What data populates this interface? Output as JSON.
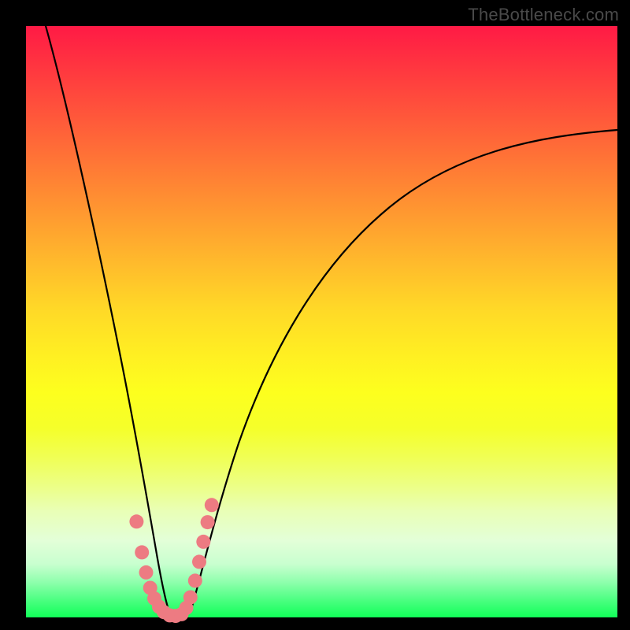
{
  "attribution": "TheBottleneck.com",
  "colors": {
    "frame": "#000000",
    "curve": "#000000",
    "marker": "#ed7b82",
    "gradient_top": "#ff1a45",
    "gradient_mid": "#fff022",
    "gradient_bottom": "#11ff58"
  },
  "chart_data": {
    "type": "line",
    "title": "",
    "xlabel": "",
    "ylabel": "",
    "xlim": [
      0,
      100
    ],
    "ylim": [
      0,
      100
    ],
    "note": "Axes are unlabeled in the source image; values below are read in percent of the plot area (0 = left/bottom, 100 = right/top). The curve resembles a V-shaped bottleneck chart.",
    "series": [
      {
        "name": "left-branch",
        "x": [
          3.4,
          5,
          7,
          9,
          11,
          13,
          15,
          17,
          18.7,
          19.7,
          20.5,
          21.2,
          21.8,
          22.4,
          23
        ],
        "y": [
          100,
          92,
          82,
          71.5,
          60.5,
          49,
          37.5,
          26,
          16,
          10.5,
          7,
          4.5,
          2.8,
          1.5,
          0.5
        ]
      },
      {
        "name": "valley",
        "x": [
          23,
          24,
          25,
          26,
          27,
          27.7
        ],
        "y": [
          0.5,
          0.1,
          0.05,
          0.1,
          0.4,
          1.0
        ]
      },
      {
        "name": "right-branch",
        "x": [
          27.7,
          29,
          31,
          34,
          38,
          43,
          49,
          56,
          64,
          73,
          83,
          94,
          100
        ],
        "y": [
          1.0,
          5,
          13,
          23,
          33.5,
          43.5,
          52.5,
          60,
          66.5,
          72,
          76.5,
          80.5,
          82.5
        ]
      }
    ],
    "markers": {
      "name": "highlighted-points",
      "color": "#ed7b82",
      "approx_radius_px": 9,
      "points_xy_pct": [
        [
          18.7,
          16.2
        ],
        [
          19.6,
          11.0
        ],
        [
          20.3,
          7.6
        ],
        [
          21.0,
          5.0
        ],
        [
          21.7,
          3.2
        ],
        [
          22.5,
          1.8
        ],
        [
          23.3,
          0.9
        ],
        [
          24.3,
          0.35
        ],
        [
          25.3,
          0.25
        ],
        [
          26.3,
          0.55
        ],
        [
          27.1,
          1.6
        ],
        [
          27.8,
          3.4
        ],
        [
          28.6,
          6.2
        ],
        [
          29.3,
          9.4
        ],
        [
          30.0,
          12.8
        ],
        [
          30.7,
          16.1
        ],
        [
          31.4,
          19.0
        ]
      ]
    }
  }
}
